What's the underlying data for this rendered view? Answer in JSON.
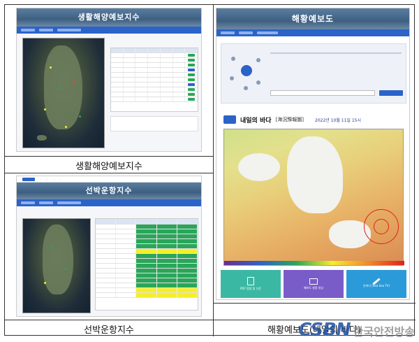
{
  "captions": {
    "top_left": "생활해양예보지수",
    "top_right": "해황예보도",
    "bottom_left": "선박운항지수",
    "bottom_right": "해황예보도(내일의 바다)"
  },
  "panel_tl": {
    "banner": "생활해양예보지수",
    "tabs": [
      "해양예보",
      "해양지수",
      "생활해양예보지수"
    ]
  },
  "panel_tr": {
    "banner": "해황예보도",
    "map_title": "내일의 바다",
    "map_title_han": "[海況豫報圖]",
    "map_date": "2022년 10월 11일 15시",
    "buttons": [
      "PDF 열람 및 다운",
      "예보도 설명 영상",
      "온바다 (Sea Sea TV)"
    ]
  },
  "panel_bl": {
    "banner": "선박운항지수",
    "nav": [
      "해양예보",
      "해양지수",
      "선박운항지수"
    ]
  },
  "watermark": {
    "logo": "CSBN",
    "text": "한국안전방송"
  },
  "colors": {
    "grade_good": "#2aa65a",
    "grade_caution": "#f5ef2a",
    "accent": "#2b63c8"
  }
}
